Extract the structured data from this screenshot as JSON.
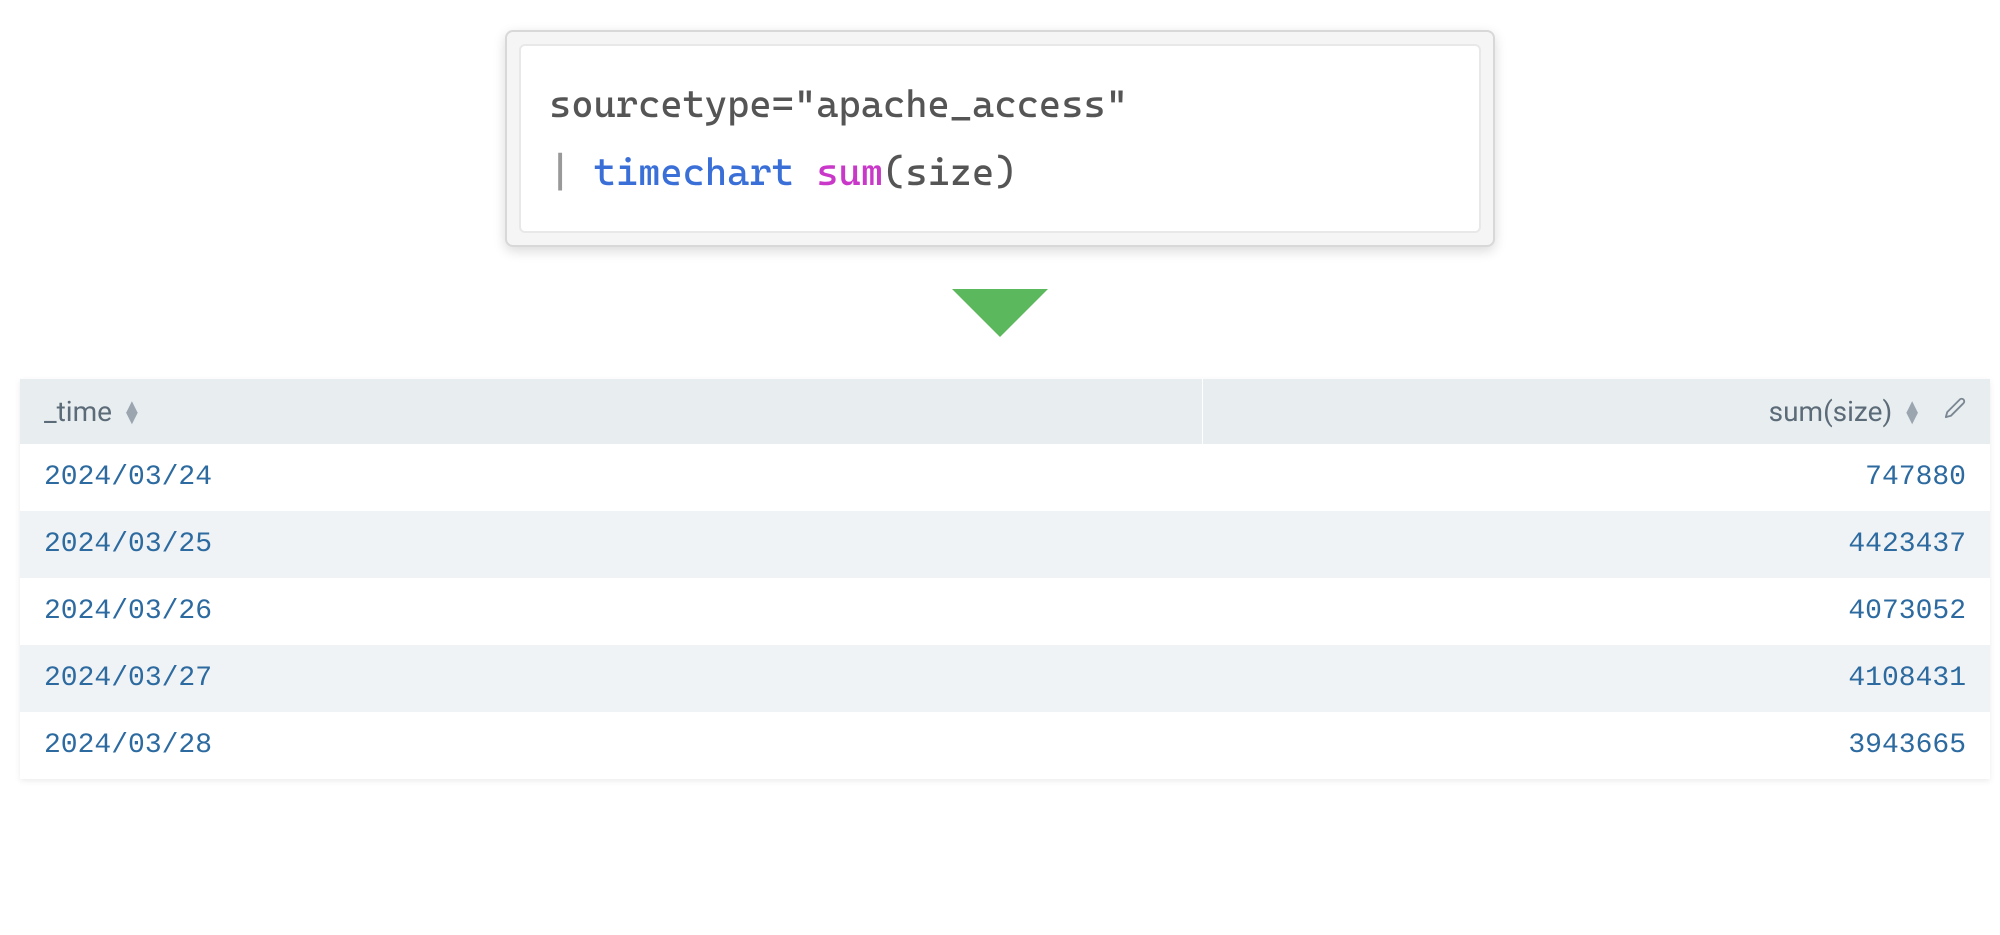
{
  "query": {
    "line1_text": "sourcetype=\"apache_access\"",
    "pipe": "|",
    "command": "timechart",
    "func": "sum",
    "arg_open": "(",
    "arg": "size",
    "arg_close": ")"
  },
  "table": {
    "headers": {
      "time": "_time",
      "sum": "sum(size)"
    },
    "rows": [
      {
        "time": "2024/03/24",
        "value": "747880"
      },
      {
        "time": "2024/03/25",
        "value": "4423437"
      },
      {
        "time": "2024/03/26",
        "value": "4073052"
      },
      {
        "time": "2024/03/27",
        "value": "4108431"
      },
      {
        "time": "2024/03/28",
        "value": "3943665"
      }
    ]
  }
}
